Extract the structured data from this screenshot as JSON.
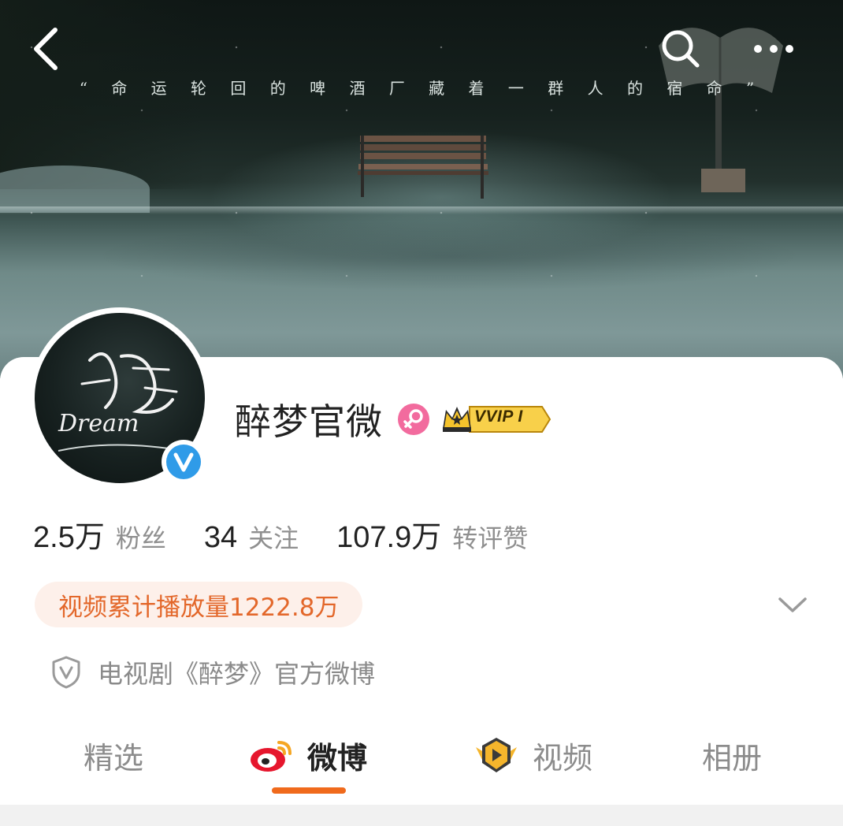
{
  "cover": {
    "quote": "“ 命 运 轮 回 的 啤 酒 厂   藏 着 一 群 人 的 宿 命 ”"
  },
  "topbar": {
    "back_icon": "chevron-left-icon",
    "search_icon": "search-icon",
    "more_icon": "more-dots-icon"
  },
  "profile": {
    "name": "醉梦官微",
    "avatar_text": "Dream",
    "vip_label": "VVIP I",
    "verified_color": "#2f9be8"
  },
  "stats": [
    {
      "num": "2.5万",
      "label": "粉丝"
    },
    {
      "num": "34",
      "label": "关注"
    },
    {
      "num": "107.9万",
      "label": "转评赞"
    }
  ],
  "play_count": "视频累计播放量1222.8万",
  "description": "电视剧《醉梦》官方微博",
  "tabs": [
    {
      "label": "精选"
    },
    {
      "label": "微博",
      "active": true
    },
    {
      "label": "视频"
    },
    {
      "label": "相册"
    }
  ],
  "colors": {
    "accent": "#f06a1c",
    "pill_text": "#e3672a",
    "pill_bg": "#fdf0ea",
    "gender_pink": "#f26b9e",
    "vip_gold": "#f5c32c"
  }
}
